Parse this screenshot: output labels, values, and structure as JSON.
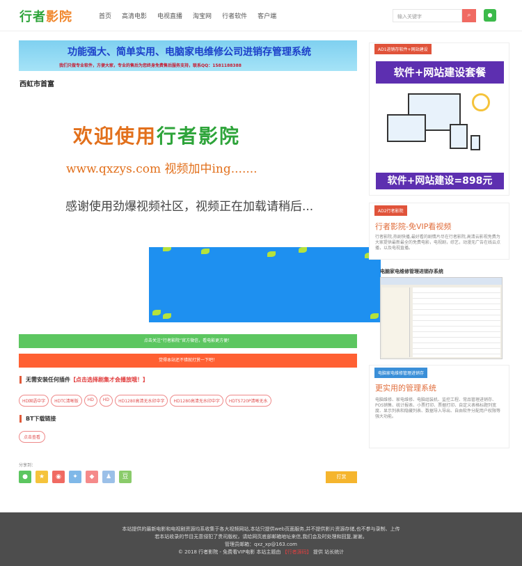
{
  "header": {
    "logo_part1": "行者",
    "logo_part2": "影院",
    "nav": [
      "首页",
      "高清电影",
      "电视直播",
      "淘宝网",
      "行者软件",
      "客户端"
    ],
    "search_placeholder": "输入关键字"
  },
  "banner": {
    "title": "功能强大、简单实用、电脑家电维修公司进销存管理系统",
    "subtitle": "我们只做专业软件，方便大家，专业的售后为您终身免费售后服务支持，联系QQ：1581188388"
  },
  "page_title": "西虹市首富",
  "player": {
    "welcome_part1": "欢迎使用",
    "welcome_part2": "行者影院",
    "url_line": "www.qxzys.com 视频加中ing.......",
    "loading": "感谢使用劲爆视频社区，视频正在加载请稍后..."
  },
  "buttons": {
    "follow": "点击关注“行者影院”官方微信，看电影更方便！",
    "slow": "觉得本站还不错就打赏一下吧！"
  },
  "plugin_section": {
    "label": "无需安装任何插件",
    "link": "【点击选择剧集才会播放哦！】"
  },
  "tags": [
    "HD国语中字",
    "HDTC清晰版",
    "HD",
    "HD",
    "HD1280高清无水印中字",
    "HD1280高清无水印中字",
    "HDTS720P清晰无水"
  ],
  "download_section": {
    "label": "BT下载链接",
    "button": "点击查看"
  },
  "share": {
    "label": "分享到：",
    "tip_button": "打赏"
  },
  "sidebar": {
    "ad1_label": "AD1进销存软件+网站建设",
    "ad1_top": "软件+网站建设套餐",
    "ad1_bottom": "软件+网站建设=898元",
    "ad2_label": "AD2行者影院",
    "ad2_title": "行者影院-免VIP看视频",
    "ad2_text": "行者影院,热剧快播,最好看的剧情片尽在行者影院,高清云影视免费为大家提供最新最全的免费电影，电视剧，综艺，动漫无广告在线云点播，以及电视直播。",
    "mgmt_subtitle": "电脑家电维修管理进销存系统",
    "mgmt_label": "电脑家电维修管理进销存",
    "mgmt_title": "更实用的管理系统",
    "mgmt_text": "电脑维修、家电维修、电脑组装机、监控工程、常品管理进销存、POS销售、统计报表、小票打印、票据打印、自定义表格标题列宽度、显示列表和隐藏列表、数据导入导出、自由软件分配用户权限等强大功能。"
  },
  "footer": {
    "line1": "本站提供的最新电影和电视剧资源均系收集于各大视频网站,本站只提供web页面服务,并不提供影片资源存储,也不参与录制、上传",
    "line2": "若本站收录的节目无意侵犯了贵司版权，请给网页底部邮箱地址来信,我们会及时处理和回复,谢谢。",
    "line3": "管理员邮箱：qxz_xp@163.com",
    "line4_a": "© 2018 行者影院 - 免费看VIP电影 本站主题由",
    "line4_b": "【行者源码】",
    "line4_c": "提供 站长统计"
  },
  "colors": {
    "green": "#5cc660",
    "red": "#ff6033",
    "accent_orange": "#e06c3a",
    "footer_bg": "#4d4d4d"
  }
}
